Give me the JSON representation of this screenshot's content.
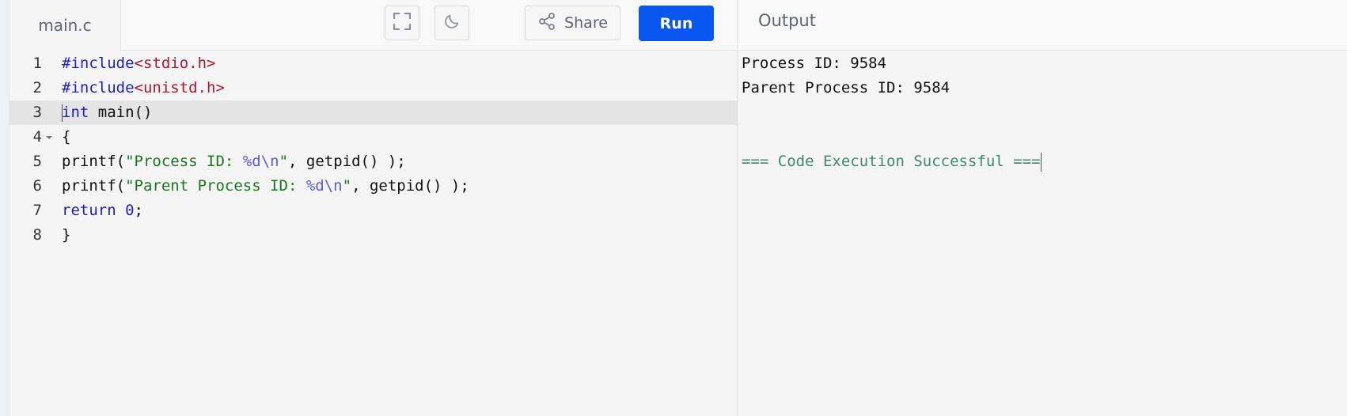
{
  "editor": {
    "file_tab": "main.c",
    "lines": [
      {
        "num": "1",
        "parts": [
          {
            "t": "#include",
            "c": "inc"
          },
          {
            "t": "<stdio.h>",
            "c": "hdr"
          }
        ]
      },
      {
        "num": "2",
        "parts": [
          {
            "t": "#include",
            "c": "inc"
          },
          {
            "t": "<unistd.h>",
            "c": "hdr"
          }
        ]
      },
      {
        "num": "3",
        "active": true,
        "cursor": true,
        "parts": [
          {
            "t": "int",
            "c": "kw"
          },
          {
            "t": " main()",
            "c": ""
          }
        ]
      },
      {
        "num": "4",
        "fold": true,
        "parts": [
          {
            "t": "{",
            "c": ""
          }
        ]
      },
      {
        "num": "5",
        "parts": [
          {
            "t": "printf(",
            "c": ""
          },
          {
            "t": "\"Process ID: ",
            "c": "str"
          },
          {
            "t": "%d\\n",
            "c": "fmt"
          },
          {
            "t": "\"",
            "c": "str"
          },
          {
            "t": ", getpid() );",
            "c": ""
          }
        ]
      },
      {
        "num": "6",
        "parts": [
          {
            "t": "printf(",
            "c": ""
          },
          {
            "t": "\"Parent Process ID: ",
            "c": "str"
          },
          {
            "t": "%d\\n",
            "c": "fmt"
          },
          {
            "t": "\"",
            "c": "str"
          },
          {
            "t": ", getpid() );",
            "c": ""
          }
        ]
      },
      {
        "num": "7",
        "parts": [
          {
            "t": "return",
            "c": "kw"
          },
          {
            "t": " ",
            "c": ""
          },
          {
            "t": "0",
            "c": "num"
          },
          {
            "t": ";",
            "c": ""
          }
        ]
      },
      {
        "num": "8",
        "parts": [
          {
            "t": "}",
            "c": ""
          }
        ]
      }
    ]
  },
  "toolbar": {
    "fullscreen_icon": "fullscreen-icon",
    "theme_icon": "moon-icon",
    "share_icon": "share-icon",
    "share_label": "Share",
    "run_label": "Run"
  },
  "output": {
    "title": "Output",
    "lines": [
      {
        "text": "Process ID: 9584",
        "type": "normal",
        "row": 0
      },
      {
        "text": "Parent Process ID: 9584",
        "type": "normal",
        "row": 1
      },
      {
        "text": "=== Code Execution Successful ===",
        "type": "success",
        "row": 4
      }
    ]
  },
  "colors": {
    "run_button": "#0a56f0",
    "keyword": "#1d1fc9",
    "header": "#b5162b",
    "string": "#19761c",
    "format": "#5a5ae0",
    "success": "#3f8a6a"
  }
}
